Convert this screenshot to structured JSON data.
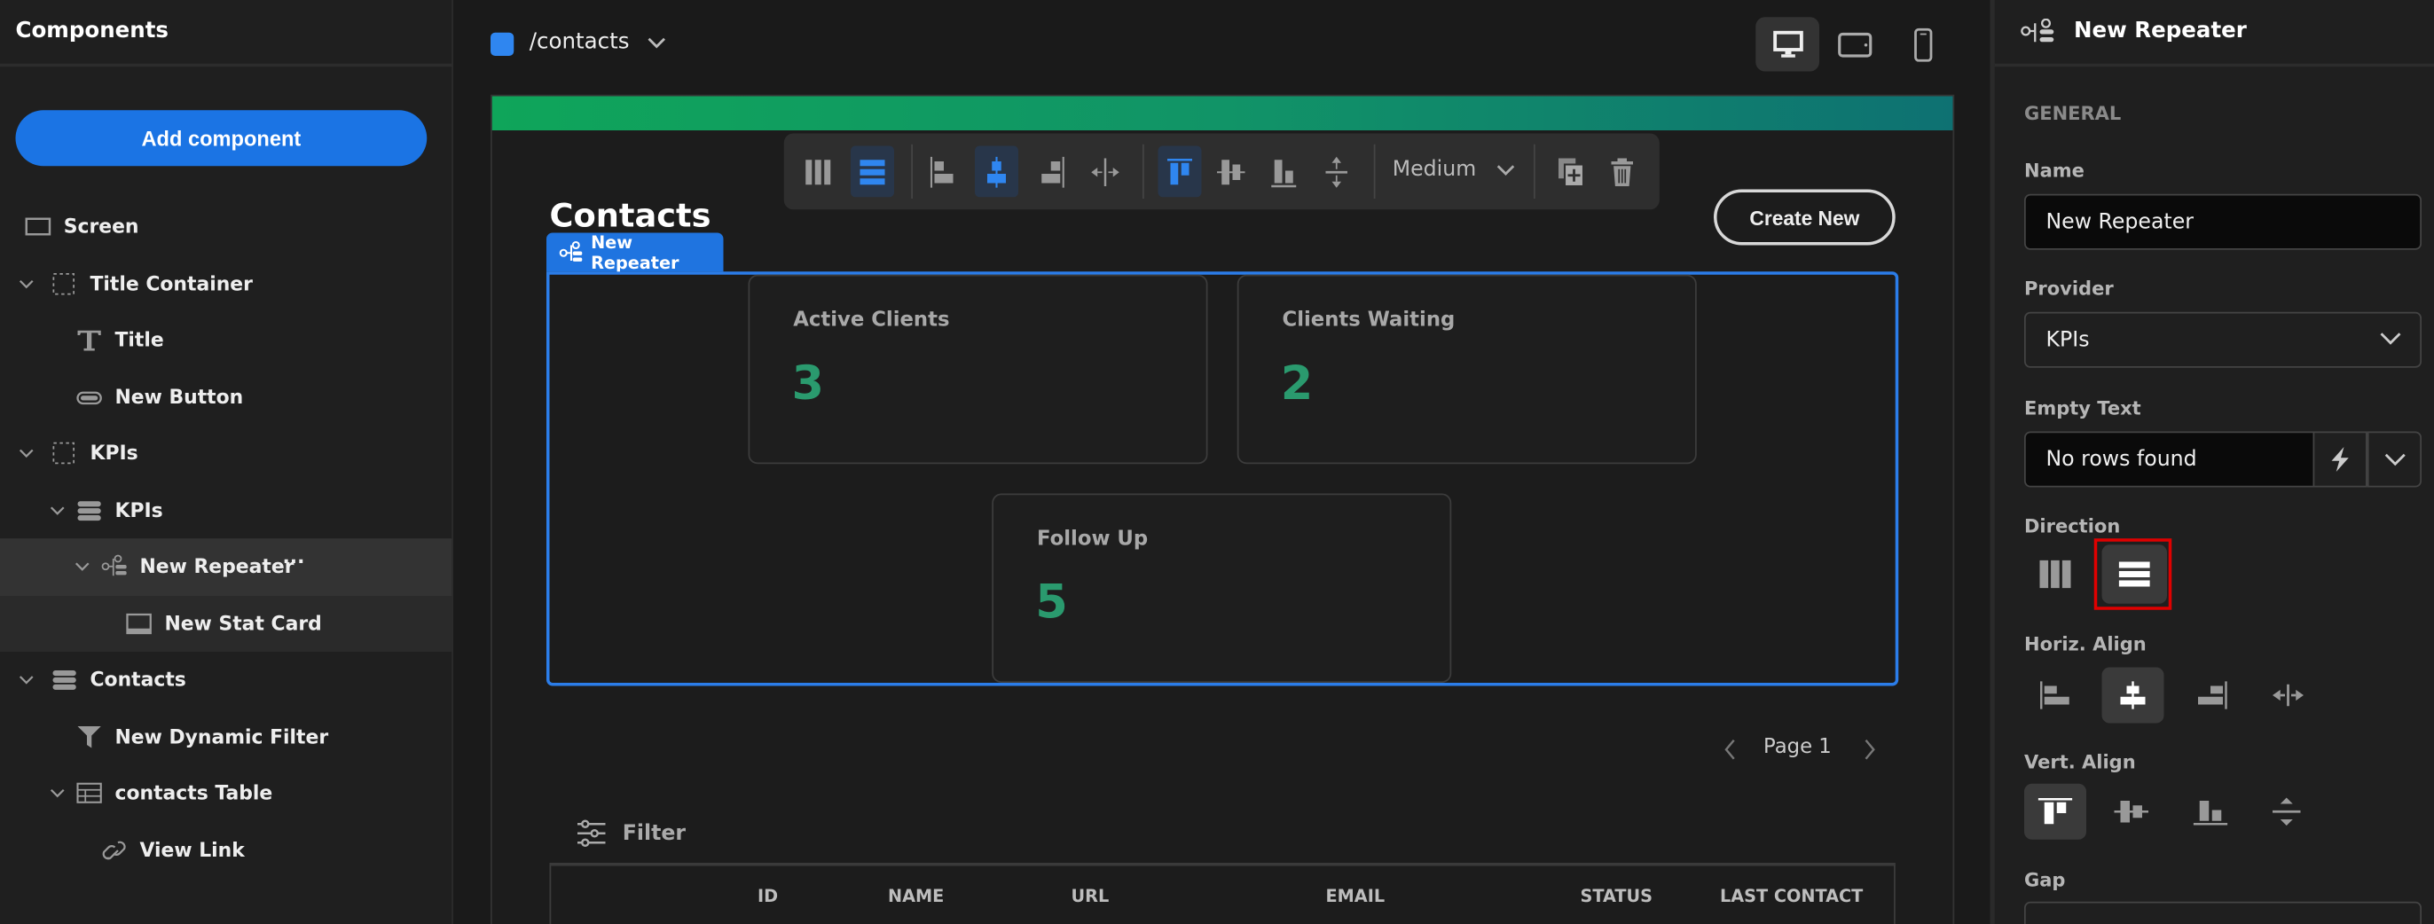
{
  "left_panel": {
    "title": "Components",
    "add_button": "Add component",
    "tree": [
      {
        "label": "Screen",
        "icon": "screen-icon"
      },
      {
        "label": "Title Container",
        "icon": "container-icon"
      },
      {
        "label": "Title",
        "icon": "text-icon"
      },
      {
        "label": "New Button",
        "icon": "button-icon"
      },
      {
        "label": "KPIs",
        "icon": "container-icon"
      },
      {
        "label": "KPIs",
        "icon": "database-icon"
      },
      {
        "label": "New Repeater",
        "icon": "repeater-icon",
        "selected": true
      },
      {
        "label": "New Stat Card",
        "icon": "stat-card-icon"
      },
      {
        "label": "Contacts",
        "icon": "database-icon"
      },
      {
        "label": "New Dynamic Filter",
        "icon": "filter-icon"
      },
      {
        "label": "contacts Table",
        "icon": "table-icon"
      },
      {
        "label": "View Link",
        "icon": "link-icon"
      }
    ],
    "more_label": "···"
  },
  "topbar": {
    "path": "/contacts",
    "device": "desktop",
    "accent": "#2f86f0"
  },
  "toolbar": {
    "gap_value": "Medium"
  },
  "canvas": {
    "title": "Contacts",
    "create_button": "Create New",
    "repeater_label": "New Repeater",
    "cards": [
      {
        "label": "Active Clients",
        "value": "3"
      },
      {
        "label": "Clients Waiting",
        "value": "2"
      },
      {
        "label": "Follow Up",
        "value": "5"
      }
    ],
    "pager": "Page 1",
    "filter": "Filter",
    "columns": [
      "ID",
      "NAME",
      "URL",
      "EMAIL",
      "STATUS",
      "LAST CONTACT"
    ],
    "value_color": "#2a9a6e"
  },
  "right_panel": {
    "title": "New Repeater",
    "section": "GENERAL",
    "name_label": "Name",
    "name_value": "New Repeater",
    "provider_label": "Provider",
    "provider_value": "KPIs",
    "empty_label": "Empty Text",
    "empty_value": "No rows found",
    "direction_label": "Direction",
    "direction": "rows",
    "halign_label": "Horiz. Align",
    "halign": "center",
    "valign_label": "Vert. Align",
    "valign": "top",
    "gap_label": "Gap"
  }
}
